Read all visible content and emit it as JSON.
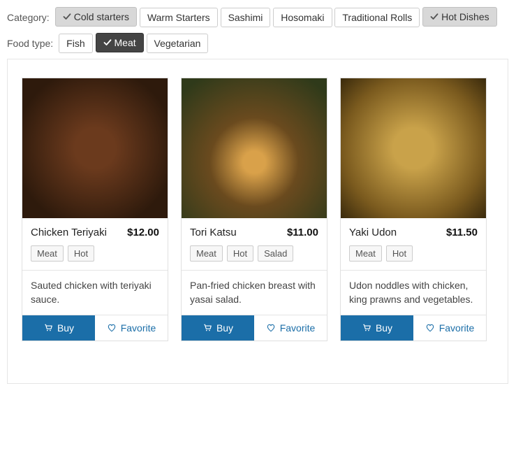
{
  "filters": {
    "category_label": "Category:",
    "food_type_label": "Food type:",
    "categories": [
      {
        "label": "Cold starters",
        "selected": true
      },
      {
        "label": "Warm Starters",
        "selected": false
      },
      {
        "label": "Sashimi",
        "selected": false
      },
      {
        "label": "Hosomaki",
        "selected": false
      },
      {
        "label": "Traditional Rolls",
        "selected": false
      },
      {
        "label": "Hot Dishes",
        "selected": true
      }
    ],
    "food_types": [
      {
        "label": "Fish",
        "selected": false,
        "dark": false
      },
      {
        "label": "Meat",
        "selected": true,
        "dark": true
      },
      {
        "label": "Vegetarian",
        "selected": false,
        "dark": false
      }
    ]
  },
  "cards": [
    {
      "title": "Chicken Teriyaki",
      "price": "$12.00",
      "tags": [
        "Meat",
        "Hot"
      ],
      "desc": "Sauted chicken with teriyaki sauce."
    },
    {
      "title": "Tori Katsu",
      "price": "$11.00",
      "tags": [
        "Meat",
        "Hot",
        "Salad"
      ],
      "desc": "Pan-fried chicken breast with yasai salad."
    },
    {
      "title": "Yaki Udon",
      "price": "$11.50",
      "tags": [
        "Meat",
        "Hot"
      ],
      "desc": "Udon noddles with chicken, king prawns and vegetables."
    }
  ],
  "actions": {
    "buy": "Buy",
    "favorite": "Favorite"
  }
}
